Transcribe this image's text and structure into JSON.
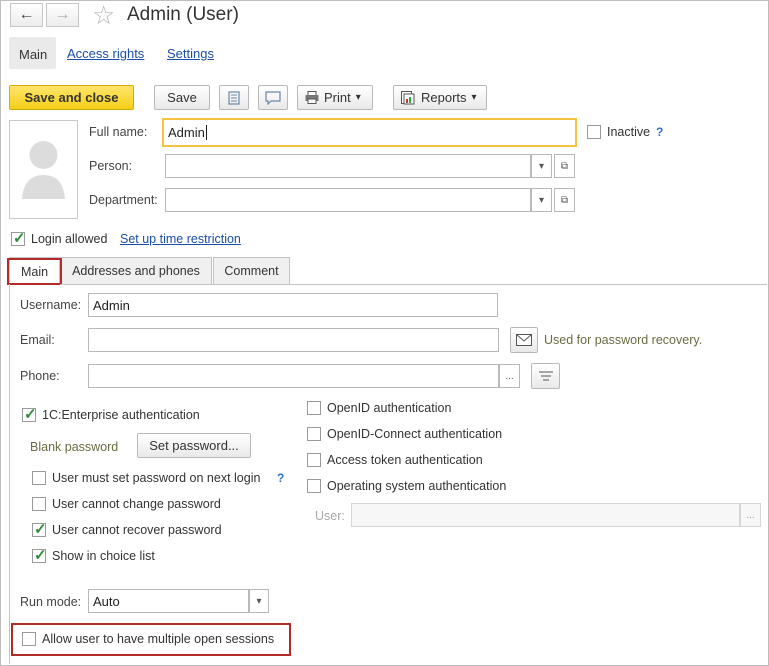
{
  "window": {
    "title": "Admin (User)"
  },
  "nav": {
    "back": "←",
    "forward": "→",
    "star": "☆"
  },
  "top_tabs": [
    {
      "label": "Main"
    },
    {
      "label": "Access rights"
    },
    {
      "label": "Settings"
    }
  ],
  "toolbar": {
    "save_close": "Save and close",
    "save": "Save",
    "print": "Print",
    "reports": "Reports",
    "dropdown_arrow": "▾"
  },
  "header": {
    "full_name_label": "Full name:",
    "full_name_value": "Admin",
    "inactive_label": "Inactive",
    "help": "?",
    "person_label": "Person:",
    "person_value": "",
    "department_label": "Department:",
    "department_value": ""
  },
  "login": {
    "allowed_label": "Login allowed",
    "allowed_checked": true,
    "time_restriction_link": "Set up time restriction"
  },
  "inner_tabs": [
    {
      "label": "Main"
    },
    {
      "label": "Addresses and phones"
    },
    {
      "label": "Comment"
    }
  ],
  "form": {
    "username_label": "Username:",
    "username_value": "Admin",
    "email_label": "Email:",
    "email_value": "",
    "email_note": "Used for password recovery.",
    "phone_label": "Phone:",
    "phone_value": "",
    "ellipsis": "...",
    "enterprise_auth_label": "1C:Enterprise authentication",
    "blank_password_label": "Blank password",
    "set_password_button": "Set password...",
    "must_set_password_label": "User must set password on next login",
    "cannot_change_password_label": "User cannot change password",
    "cannot_recover_password_label": "User cannot recover password",
    "show_in_choice_list_label": "Show in choice list",
    "openid_label": "OpenID authentication",
    "openid_connect_label": "OpenID-Connect authentication",
    "access_token_label": "Access token authentication",
    "os_auth_label": "Operating system authentication",
    "os_user_label": "User:",
    "os_user_value": "",
    "run_mode_label": "Run mode:",
    "run_mode_value": "Auto",
    "multiple_sessions_label": "Allow user to have multiple open sessions"
  },
  "colors": {
    "accent_yellow": "#f5cf17",
    "link_blue": "#1a4ea8",
    "highlight_red": "#b22a2a",
    "check_green": "#2e8b3a"
  }
}
